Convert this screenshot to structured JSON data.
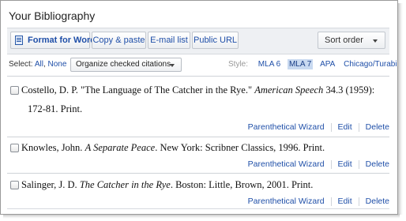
{
  "title": "Your Bibliography",
  "toolbar": {
    "format_for_word": "Format for Word",
    "copy_paste": "Copy & paste",
    "email_list": "E-mail list",
    "public_url": "Public URL",
    "sort_order": "Sort order"
  },
  "selection": {
    "select_label": "Select:",
    "all": "All",
    "comma": ",",
    "none": "None",
    "organize": "Organize checked citations"
  },
  "styles": {
    "label": "Style:",
    "options": [
      "MLA 6",
      "MLA 7",
      "APA",
      "Chicago/Turabian"
    ],
    "selected": "MLA 7"
  },
  "citations": [
    {
      "part1": "Costello, D. P. \"The Language of The Catcher in the Rye.\" ",
      "italic": "American Speech",
      "part2": " 34.3 (1959):",
      "line2": "172-81. Print."
    },
    {
      "part1": "Knowles, John. ",
      "italic": "A Separate Peace",
      "part2": ". New York: Scribner Classics, 1996. Print."
    },
    {
      "part1": "Salinger, J. D. ",
      "italic": "The Catcher in the Rye",
      "part2": ". Boston: Little, Brown, 2001. Print."
    }
  ],
  "actions": {
    "wizard": "Parenthetical Wizard",
    "edit": "Edit",
    "delete": "Delete"
  },
  "colors": {
    "link": "#1f4fa8",
    "selected_style_bg": "#c8d9f0"
  }
}
